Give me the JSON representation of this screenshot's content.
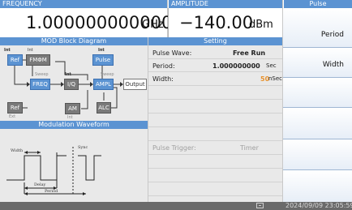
{
  "header": {
    "frequency_label": "FREQUENCY",
    "amplitude_label": "AMPLITUDE",
    "softkey_title": "Pulse"
  },
  "frequency": {
    "value": "1.000000000000",
    "unit": "GHz"
  },
  "amplitude": {
    "value": "−140.00",
    "unit": "dBm"
  },
  "mod_block": {
    "title": "MOD Block Diagram",
    "blocks": {
      "ref": "Ref",
      "fm": "FMΦM",
      "pulse": "Pulse",
      "freq": "FREQ",
      "iq": "I/Q",
      "ampl": "AMPL",
      "output": "Output",
      "ref_ext": "Ref",
      "am": "AM",
      "alc": "ALC"
    },
    "small": {
      "int1": "Int",
      "int2": "Int",
      "int3": "Int",
      "int4": "Int",
      "sweep1": "Sweep",
      "sweep2": "Sweep",
      "ext": "Ext",
      "int5": "Int"
    }
  },
  "setting": {
    "title": "Setting",
    "rows": [
      {
        "label": "Pulse Wave:",
        "value": "Free Run",
        "unit": ""
      },
      {
        "label": "Period:",
        "value": "1.000000000",
        "unit": "Sec"
      },
      {
        "label": "Width:",
        "value": "50",
        "unit": "nSec"
      }
    ],
    "trigger_label": "Pulse Trigger:",
    "trigger_value": "Timer"
  },
  "waveform": {
    "title": "Modulation Waveform",
    "width_label": "Width",
    "sync_label": "Sync",
    "delay_label": "Delay",
    "period_label": "Period"
  },
  "softkeys": [
    "Period",
    "Width",
    "",
    "",
    "",
    ""
  ],
  "status": {
    "datetime": "2024/09/09 23:05:59"
  },
  "colors": {
    "header_blue": "#5b93d2",
    "width_value": "#e8922e"
  }
}
